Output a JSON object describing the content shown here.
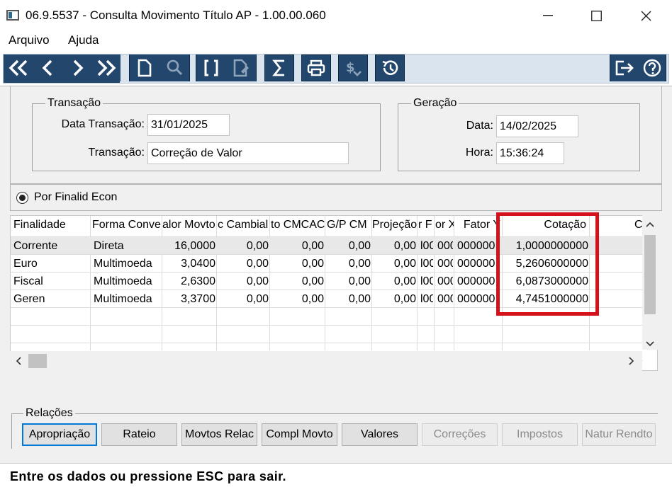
{
  "window": {
    "title": "06.9.5537 - Consulta Movimento Título AP - 1.00.00.060"
  },
  "menu": {
    "items": [
      "Arquivo",
      "Ajuda"
    ]
  },
  "toolbar": {
    "buttons": [
      "first-icon",
      "prev-icon",
      "next-icon",
      "last-icon",
      "new-document-icon",
      "search-icon",
      "brackets-icon",
      "edit-document-icon",
      "sum-icon",
      "print-icon",
      "currency-icon",
      "history-icon",
      "exit-icon",
      "help-icon"
    ]
  },
  "transacao": {
    "legend": "Transação",
    "data_label": "Data Transação:",
    "data_value": "31/01/2025",
    "tipo_label": "Transação:",
    "tipo_value": "Correção de Valor"
  },
  "geracao": {
    "legend": "Geração",
    "data_label": "Data:",
    "data_value": "14/02/2025",
    "hora_label": "Hora:",
    "hora_value": "15:36:24"
  },
  "radio": {
    "label": "Por Finalid Econ"
  },
  "table": {
    "headers": [
      "Finalidade",
      "Forma Conve",
      "alor Movto",
      "c Cambial",
      "to CMCAC",
      "G/P CM",
      "Projeção",
      "r F",
      "or X",
      "Fator Y",
      "Cotação",
      "C"
    ],
    "rows": [
      [
        "Corrente",
        "Direta",
        "16,0000",
        "0,00",
        "0,00",
        "0,00",
        "0,00",
        "l00",
        "000",
        "000000",
        "1,0000000000"
      ],
      [
        "Euro",
        "Multimoeda",
        "3,0400",
        "0,00",
        "0,00",
        "0,00",
        "0,00",
        "l00",
        "000",
        "000000",
        "5,2606000000"
      ],
      [
        "Fiscal",
        "Multimoeda",
        "2,6300",
        "0,00",
        "0,00",
        "0,00",
        "0,00",
        "l00",
        "000",
        "000000",
        "6,0873000000"
      ],
      [
        "Geren",
        "Multimoeda",
        "3,3700",
        "0,00",
        "0,00",
        "0,00",
        "0,00",
        "l00",
        "000",
        "000000",
        "4,7451000000"
      ]
    ]
  },
  "relacoes": {
    "legend": "Relações",
    "buttons": [
      "Apropriação",
      "Rateio",
      "Movtos Relac",
      "Compl Movto",
      "Valores",
      "Correções",
      "Impostos",
      "Natur Rendto"
    ]
  },
  "status": {
    "text": "Entre os dados ou pressione ESC para sair."
  },
  "colors": {
    "toolbar_button": "#23466c",
    "highlight": "#d4121c"
  }
}
